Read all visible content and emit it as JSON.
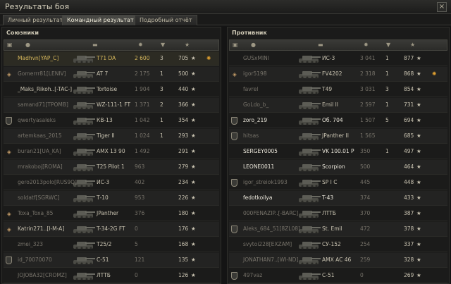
{
  "window": {
    "title": "Результаты боя",
    "close": "×"
  },
  "tabs": [
    {
      "label": "Личный результат",
      "active": false
    },
    {
      "label": "Командный результат",
      "active": true
    },
    {
      "label": "Подробный отчёт",
      "active": false
    }
  ],
  "allies": {
    "title": "Союзники",
    "rows": [
      {
        "player": "Madhvn[YAP_C]",
        "tank": "T71 DA",
        "dmg": "2 600",
        "kills": "3",
        "xp": "705",
        "icon": "",
        "style": "me",
        "medal": true
      },
      {
        "player": "Gomerrr81[LENIV]",
        "tank": "AT 7",
        "dmg": "2 175",
        "kills": "1",
        "xp": "500",
        "icon": "platoon",
        "style": "dim",
        "medal": false
      },
      {
        "player": "_Maks_Rikoh..[-TAC-]",
        "tank": "Tortoise",
        "dmg": "1 904",
        "kills": "3",
        "xp": "440",
        "icon": "",
        "style": "n",
        "medal": false
      },
      {
        "player": "samand71[TPOMB]",
        "tank": "WZ-111-1 FT",
        "dmg": "1 371",
        "kills": "2",
        "xp": "366",
        "icon": "",
        "style": "dim",
        "medal": false
      },
      {
        "player": "qwertyasaleks",
        "tank": "КВ-13",
        "dmg": "1 042",
        "kills": "1",
        "xp": "354",
        "icon": "badge",
        "style": "dim",
        "medal": false
      },
      {
        "player": "artemkaas_2015",
        "tank": "Tiger II",
        "dmg": "1 024",
        "kills": "1",
        "xp": "293",
        "icon": "",
        "style": "dim",
        "medal": false
      },
      {
        "player": "buran21[UA_KA]",
        "tank": "AMX 13 90",
        "dmg": "1 492",
        "kills": "",
        "xp": "291",
        "icon": "platoon",
        "style": "dim",
        "medal": false
      },
      {
        "player": "mrakoboj[ROMA]",
        "tank": "T25 Pilot 1",
        "dmg": "963",
        "kills": "",
        "xp": "279",
        "icon": "",
        "style": "dim",
        "medal": false
      },
      {
        "player": "gero2013polo[RUS9Q]",
        "tank": "ИС-3",
        "dmg": "402",
        "kills": "",
        "xp": "234",
        "icon": "",
        "style": "dim",
        "medal": false
      },
      {
        "player": "soldatf[SGRWC]",
        "tank": "Т-10",
        "dmg": "953",
        "kills": "",
        "xp": "226",
        "icon": "",
        "style": "dim",
        "medal": false
      },
      {
        "player": "Toxa_Toxa_85",
        "tank": "JPanther",
        "dmg": "376",
        "kills": "",
        "xp": "180",
        "icon": "platoon",
        "style": "dim",
        "medal": false
      },
      {
        "player": "Katrin271..[I-M-A]",
        "tank": "T-34-2G FT",
        "dmg": "0",
        "kills": "",
        "xp": "176",
        "icon": "platoon",
        "style": "n",
        "medal": false
      },
      {
        "player": "zmei_323",
        "tank": "T25/2",
        "dmg": "5",
        "kills": "",
        "xp": "168",
        "icon": "",
        "style": "dim",
        "medal": false
      },
      {
        "player": "id_70070070",
        "tank": "С-51",
        "dmg": "121",
        "kills": "",
        "xp": "135",
        "icon": "badge",
        "style": "dim",
        "medal": false
      },
      {
        "player": "JOJOBA32[CROMZ]",
        "tank": "ЛТТБ",
        "dmg": "0",
        "kills": "",
        "xp": "126",
        "icon": "",
        "style": "dim",
        "medal": false
      }
    ]
  },
  "enemies": {
    "title": "Противник",
    "rows": [
      {
        "player": "GUSxMINI",
        "tank": "ИС-3",
        "dmg": "3 041",
        "kills": "1",
        "xp": "877",
        "icon": "",
        "style": "dim",
        "medal": false
      },
      {
        "player": "igor5198",
        "tank": "FV4202",
        "dmg": "2 318",
        "kills": "1",
        "xp": "868",
        "icon": "platoon",
        "style": "dim",
        "medal": true
      },
      {
        "player": "favrel",
        "tank": "T49",
        "dmg": "3 031",
        "kills": "3",
        "xp": "854",
        "icon": "",
        "style": "dim",
        "medal": false
      },
      {
        "player": "GoLdo_b_",
        "tank": "Emil II",
        "dmg": "2 597",
        "kills": "1",
        "xp": "731",
        "icon": "",
        "style": "dim",
        "medal": false
      },
      {
        "player": "zoro_219",
        "tank": "Об. 704",
        "dmg": "1 507",
        "kills": "5",
        "xp": "694",
        "icon": "badge",
        "style": "white",
        "medal": false
      },
      {
        "player": "hitsas",
        "tank": "JPanther II",
        "dmg": "1 565",
        "kills": "",
        "xp": "685",
        "icon": "badge",
        "style": "dim",
        "medal": false
      },
      {
        "player": "SERGEY0005",
        "tank": "VK 100.01 P",
        "dmg": "350",
        "kills": "1",
        "xp": "497",
        "icon": "",
        "style": "white",
        "medal": false
      },
      {
        "player": "LEONE0011",
        "tank": "Scorpion",
        "dmg": "500",
        "kills": "",
        "xp": "464",
        "icon": "",
        "style": "white",
        "medal": false
      },
      {
        "player": "igor_streiok1993",
        "tank": "SP I C",
        "dmg": "445",
        "kills": "",
        "xp": "448",
        "icon": "badge",
        "style": "dim",
        "medal": false
      },
      {
        "player": "fedotkoilya",
        "tank": "T-43",
        "dmg": "374",
        "kills": "",
        "xp": "433",
        "icon": "",
        "style": "white",
        "medal": false
      },
      {
        "player": "000FENAZIP..[-BARC]",
        "tank": "ЛТТБ",
        "dmg": "370",
        "kills": "",
        "xp": "387",
        "icon": "",
        "style": "dim",
        "medal": false
      },
      {
        "player": "Aleks_684_51[8ZL08]",
        "tank": "St. Emil",
        "dmg": "472",
        "kills": "",
        "xp": "378",
        "icon": "badge",
        "style": "dim",
        "medal": false
      },
      {
        "player": "svytoi228[EXZAM]",
        "tank": "СУ-152",
        "dmg": "254",
        "kills": "",
        "xp": "337",
        "icon": "",
        "style": "dim",
        "medal": false
      },
      {
        "player": "JONATHAN7..[WI-ND]",
        "tank": "AMX AC 46",
        "dmg": "259",
        "kills": "",
        "xp": "328",
        "icon": "",
        "style": "dim",
        "medal": false
      },
      {
        "player": "497vaz",
        "tank": "С-51",
        "dmg": "0",
        "kills": "",
        "xp": "269",
        "icon": "badge",
        "style": "dim",
        "medal": false
      }
    ]
  }
}
